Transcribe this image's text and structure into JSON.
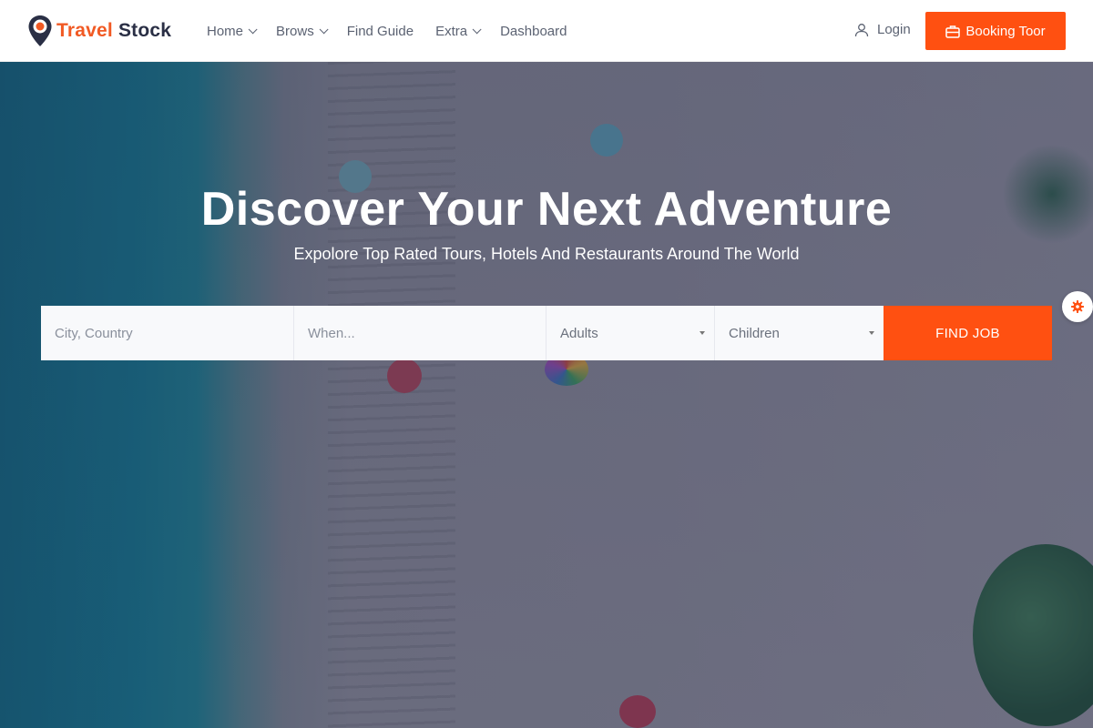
{
  "brand": {
    "part1": "Travel",
    "part2": "Stock",
    "accent_color": "#ff5011",
    "dark_color": "#2a2f45",
    "logo_icon": "map-pin-icon"
  },
  "nav": {
    "items": [
      {
        "label": "Home",
        "has_dropdown": true
      },
      {
        "label": "Brows",
        "has_dropdown": true
      },
      {
        "label": "Find Guide",
        "has_dropdown": false
      },
      {
        "label": "Extra",
        "has_dropdown": true
      },
      {
        "label": "Dashboard",
        "has_dropdown": false
      }
    ]
  },
  "header": {
    "login_label": "Login",
    "login_icon": "user-icon",
    "booking_label": "Booking Toor",
    "booking_icon": "bag-icon"
  },
  "hero": {
    "title": "Discover Your Next Adventure",
    "subtitle": "Expolore Top Rated Tours, Hotels And Restaurants Around The World"
  },
  "search": {
    "city_placeholder": "City, Country",
    "when_placeholder": "When...",
    "adults_value": "Adults",
    "children_value": "Children",
    "submit_label": "FIND JOB"
  },
  "settings": {
    "icon": "gear-icon"
  }
}
